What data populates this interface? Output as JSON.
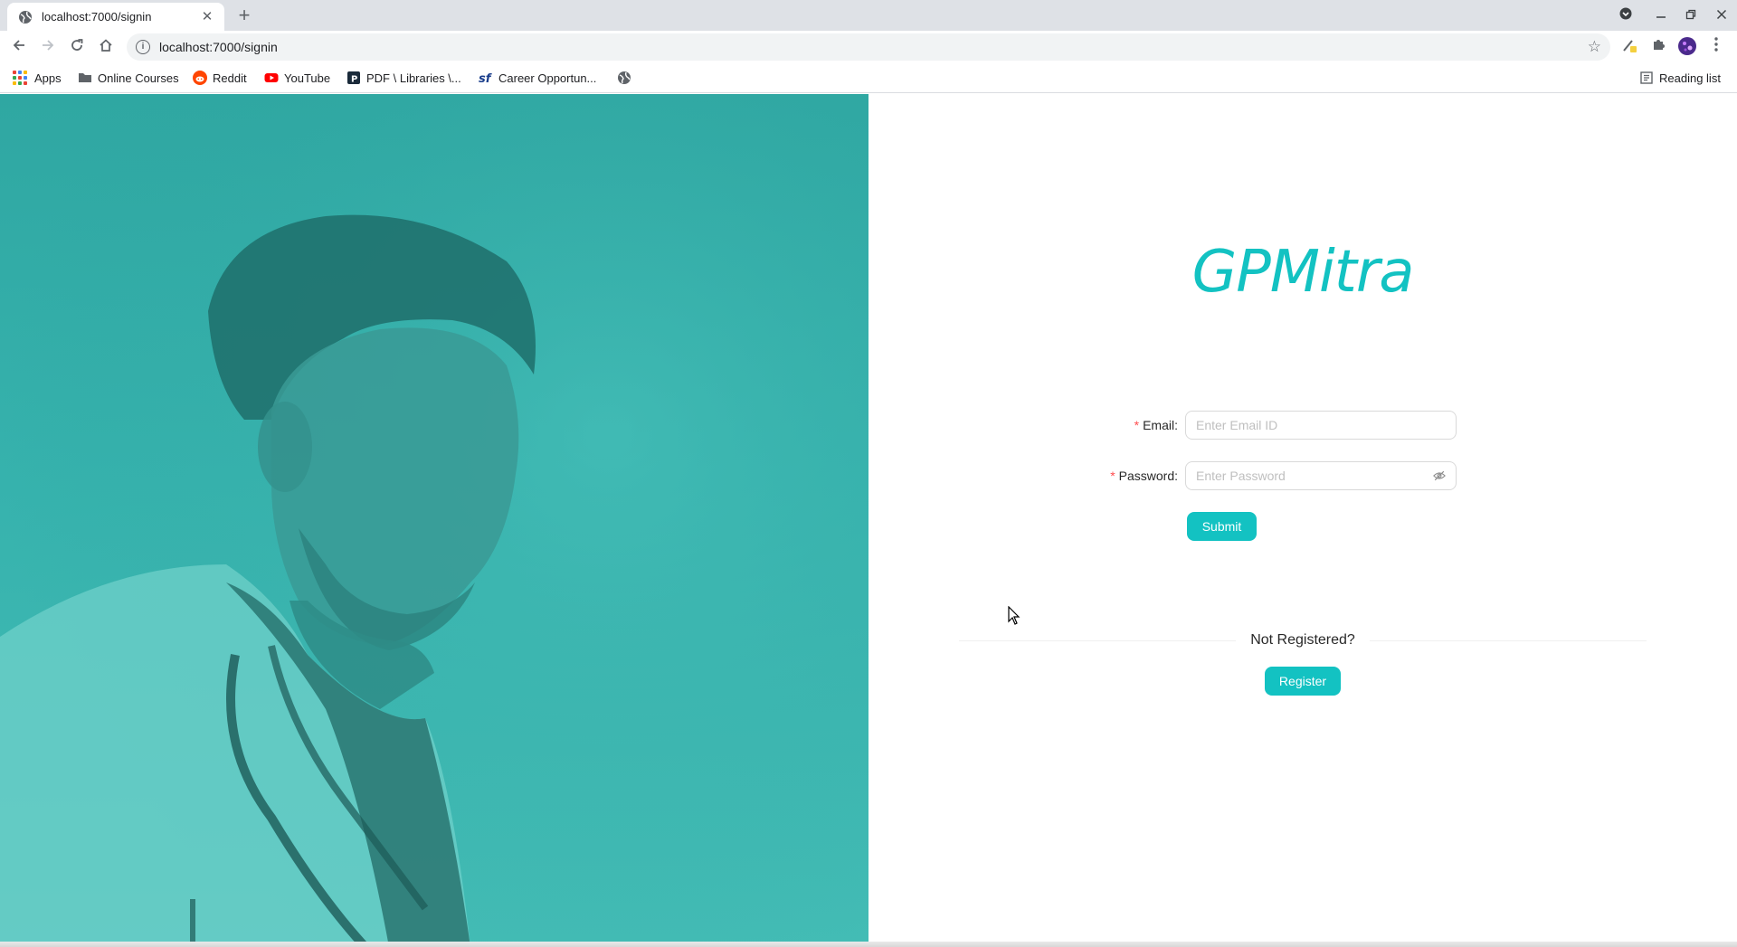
{
  "browser": {
    "tab_title": "localhost:7000/signin",
    "new_tab_symbol": "+",
    "close_symbol": "✕",
    "url": "localhost:7000/signin",
    "bookmarks": [
      {
        "label": "Apps",
        "icon": "apps-grid-icon"
      },
      {
        "label": "Online Courses",
        "icon": "folder-icon"
      },
      {
        "label": "Reddit",
        "icon": "reddit-icon"
      },
      {
        "label": "YouTube",
        "icon": "youtube-icon"
      },
      {
        "label": "PDF \\ Libraries \\...",
        "icon": "pdf-icon"
      },
      {
        "label": "Career Opportun...",
        "icon": "sf-icon"
      },
      {
        "label": "",
        "icon": "globe-icon"
      }
    ],
    "reading_list": "Reading list"
  },
  "signin": {
    "logo": "GPMitra",
    "email_label": "Email",
    "email_placeholder": "Enter Email ID",
    "password_label": "Password",
    "password_placeholder": "Enter Password",
    "submit_label": "Submit",
    "not_registered": "Not Registered?",
    "register_label": "Register",
    "required_mark": "*",
    "colon": ":"
  },
  "colors": {
    "accent": "#13c2c2",
    "hero": "#36b2ad",
    "required": "#ff4d4f"
  }
}
